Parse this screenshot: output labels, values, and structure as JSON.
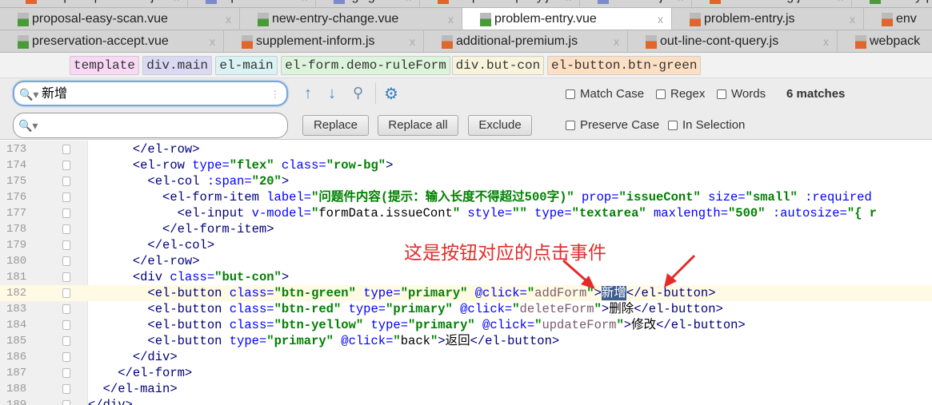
{
  "tabs": {
    "row1": [
      {
        "label": "webpack.prod.conf.js",
        "icon": "js"
      },
      {
        "label": ".npmrc",
        "icon": "cfg"
      },
      {
        "label": ".gitignore",
        "icon": "cfg"
      },
      {
        "label": "suspense-query.js",
        "icon": "js"
      },
      {
        "label": ".eslintrc.js",
        "icon": "cfg"
      },
      {
        "label": "underwriting.js",
        "icon": "js"
      },
      {
        "label": "modify-p",
        "icon": "vue"
      }
    ],
    "row2": [
      {
        "label": "proposal-easy-scan.vue",
        "icon": "vue"
      },
      {
        "label": "new-entry-change.vue",
        "icon": "vue"
      },
      {
        "label": "problem-entry.vue",
        "icon": "vue",
        "active": true
      },
      {
        "label": "problem-entry.js",
        "icon": "js"
      },
      {
        "label": "env",
        "icon": "js"
      }
    ],
    "row3": [
      {
        "label": "preservation-accept.vue",
        "icon": "vue"
      },
      {
        "label": "supplement-inform.js",
        "icon": "js"
      },
      {
        "label": "additional-premium.js",
        "icon": "js"
      },
      {
        "label": "out-line-cont-query.js",
        "icon": "js"
      },
      {
        "label": "webpack",
        "icon": "js"
      }
    ],
    "close": "x"
  },
  "breadcrumb": [
    "template",
    "div.main",
    "el-main",
    "el-form.demo-ruleForm",
    "div.but-con",
    "el-button.btn-green"
  ],
  "breadcrumb_colors": [
    "#f8d8f4",
    "#d9d9f4",
    "#d9f2f4",
    "#dcf4dc",
    "#f8f4dc",
    "#fde0c4"
  ],
  "find": {
    "search_value": "新增",
    "replace_value": "",
    "replace": "Replace",
    "replace_all": "Replace all",
    "exclude": "Exclude",
    "match_case": "Match Case",
    "regex": "Regex",
    "words": "Words",
    "matches": "6 matches",
    "preserve_case": "Preserve Case",
    "in_selection": "In Selection"
  },
  "annotation": "这是按钮对应的点击事件",
  "annotation_color": "#e52a2a",
  "current_line": 182,
  "lines": [
    {
      "n": "173",
      "i": 6,
      "t": [
        [
          "tag",
          "</el-row>"
        ]
      ]
    },
    {
      "n": "174",
      "i": 6,
      "t": [
        [
          "tag",
          "<el-row "
        ],
        [
          "attr",
          "type="
        ],
        [
          "val",
          "\"flex\" "
        ],
        [
          "attr",
          "class="
        ],
        [
          "val",
          "\"row-bg\""
        ],
        [
          "tag",
          ">"
        ]
      ]
    },
    {
      "n": "175",
      "i": 8,
      "t": [
        [
          "tag",
          "<el-col "
        ],
        [
          "attr",
          ":span="
        ],
        [
          "val",
          "\"20\""
        ],
        [
          "tag",
          ">"
        ]
      ]
    },
    {
      "n": "176",
      "i": 10,
      "t": [
        [
          "tag",
          "<el-form-item "
        ],
        [
          "attr",
          "label="
        ],
        [
          "val",
          "\"问题件内容(提示：输入长度不得超过500字)\" "
        ],
        [
          "attr",
          "prop="
        ],
        [
          "val",
          "\"issueCont\" "
        ],
        [
          "attr",
          "size="
        ],
        [
          "val",
          "\"small\" "
        ],
        [
          "attr",
          ":required"
        ]
      ]
    },
    {
      "n": "177",
      "i": 12,
      "t": [
        [
          "tag",
          "<el-input "
        ],
        [
          "attr",
          "v-model="
        ],
        [
          "val",
          "\""
        ],
        [
          "txt",
          "formData.issueCont"
        ],
        [
          "val",
          "\" "
        ],
        [
          "attr",
          "style="
        ],
        [
          "val",
          "\"\" "
        ],
        [
          "attr",
          "type="
        ],
        [
          "val",
          "\"textarea\" "
        ],
        [
          "attr",
          "maxlength="
        ],
        [
          "val",
          "\"500\" "
        ],
        [
          "attr",
          ":autosize="
        ],
        [
          "val",
          "\"{ r"
        ]
      ]
    },
    {
      "n": "178",
      "i": 10,
      "t": [
        [
          "tag",
          "</el-form-item>"
        ]
      ]
    },
    {
      "n": "179",
      "i": 8,
      "t": [
        [
          "tag",
          "</el-col>"
        ]
      ]
    },
    {
      "n": "180",
      "i": 6,
      "t": [
        [
          "tag",
          "</el-row>"
        ]
      ]
    },
    {
      "n": "181",
      "i": 6,
      "t": [
        [
          "tag",
          "<div "
        ],
        [
          "attr",
          "class="
        ],
        [
          "val",
          "\"but-con\""
        ],
        [
          "tag",
          ">"
        ]
      ]
    },
    {
      "n": "182",
      "i": 8,
      "t": [
        [
          "tag",
          "<el-button "
        ],
        [
          "attr",
          "class="
        ],
        [
          "val",
          "\"btn-green\" "
        ],
        [
          "attr",
          "type="
        ],
        [
          "val",
          "\"primary\" "
        ],
        [
          "attr",
          "@click="
        ],
        [
          "val",
          "\""
        ],
        [
          "fn",
          "addForm"
        ],
        [
          "val",
          "\""
        ],
        [
          "tag",
          ">"
        ],
        [
          "sel",
          "新增"
        ],
        [
          "tag",
          "</el-button>"
        ]
      ]
    },
    {
      "n": "183",
      "i": 8,
      "t": [
        [
          "tag",
          "<el-button "
        ],
        [
          "attr",
          "class="
        ],
        [
          "val",
          "\"btn-red\" "
        ],
        [
          "attr",
          "type="
        ],
        [
          "val",
          "\"primary\" "
        ],
        [
          "attr",
          "@click="
        ],
        [
          "val",
          "\""
        ],
        [
          "fn",
          "deleteForm"
        ],
        [
          "val",
          "\""
        ],
        [
          "tag",
          ">"
        ],
        [
          "txt",
          "删除"
        ],
        [
          "tag",
          "</el-button>"
        ]
      ]
    },
    {
      "n": "184",
      "i": 8,
      "t": [
        [
          "tag",
          "<el-button "
        ],
        [
          "attr",
          "class="
        ],
        [
          "val",
          "\"btn-yellow\" "
        ],
        [
          "attr",
          "type="
        ],
        [
          "val",
          "\"primary\" "
        ],
        [
          "attr",
          "@click="
        ],
        [
          "val",
          "\""
        ],
        [
          "fn",
          "updateForm"
        ],
        [
          "val",
          "\""
        ],
        [
          "tag",
          ">"
        ],
        [
          "txt",
          "修改"
        ],
        [
          "tag",
          "</el-button>"
        ]
      ]
    },
    {
      "n": "185",
      "i": 8,
      "t": [
        [
          "tag",
          "<el-button "
        ],
        [
          "attr",
          "type="
        ],
        [
          "val",
          "\"primary\" "
        ],
        [
          "attr",
          "@click="
        ],
        [
          "val",
          "\""
        ],
        [
          "txt",
          "back"
        ],
        [
          "val",
          "\""
        ],
        [
          "tag",
          ">"
        ],
        [
          "txt",
          "返回"
        ],
        [
          "tag",
          "</el-button>"
        ]
      ]
    },
    {
      "n": "186",
      "i": 6,
      "t": [
        [
          "tag",
          "</div>"
        ]
      ]
    },
    {
      "n": "187",
      "i": 4,
      "t": [
        [
          "tag",
          "</el-form>"
        ]
      ]
    },
    {
      "n": "188",
      "i": 2,
      "t": [
        [
          "tag",
          "</el-main>"
        ]
      ]
    },
    {
      "n": "189",
      "i": 0,
      "t": [
        [
          "tag",
          "</div>"
        ]
      ]
    }
  ]
}
